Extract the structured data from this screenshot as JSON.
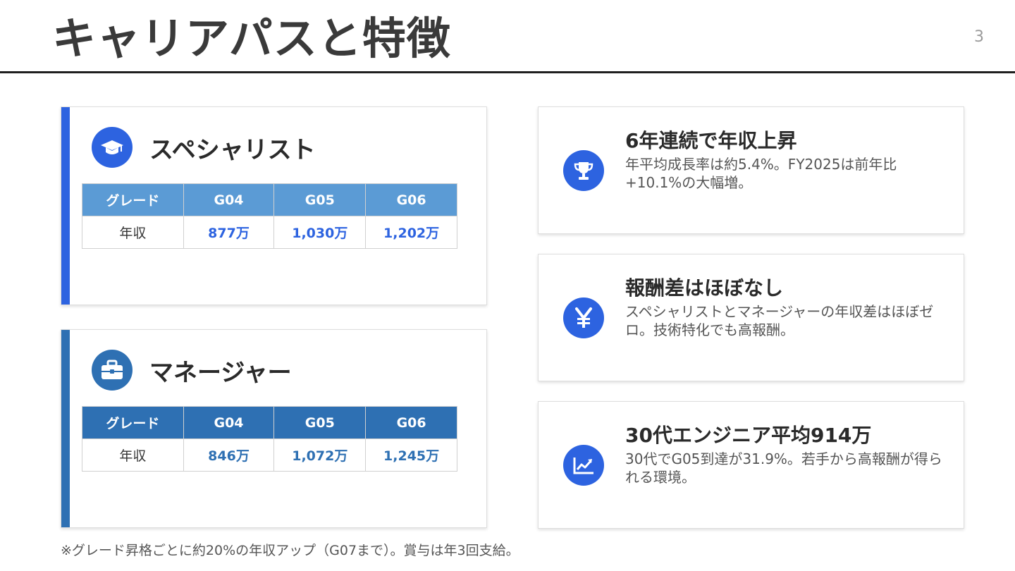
{
  "title": "キャリアパスと特徴",
  "page_number": "3",
  "specialist": {
    "icon": "graduation-cap-icon",
    "title": "スペシャリスト",
    "headers": [
      "グレード",
      "G04",
      "G05",
      "G06"
    ],
    "row_label": "年収",
    "values": [
      "877万",
      "1,030万",
      "1,202万"
    ]
  },
  "manager": {
    "icon": "briefcase-icon",
    "title": "マネージャー",
    "headers": [
      "グレード",
      "G04",
      "G05",
      "G06"
    ],
    "row_label": "年収",
    "values": [
      "846万",
      "1,072万",
      "1,245万"
    ]
  },
  "features": [
    {
      "icon": "trophy-icon",
      "title": "6年連続で年収上昇",
      "description": "年平均成長率は約5.4%。FY2025は前年比+10.1%の大幅増。"
    },
    {
      "icon": "yen-icon",
      "title": "報酬差はほぼなし",
      "description": "スペシャリストとマネージャーの年収差はほぼゼロ。技術特化でも高報酬。"
    },
    {
      "icon": "trend-chart-icon",
      "title": "30代エンジニア平均914万",
      "description": "30代でG05到達が31.9%。若手から高報酬が得られる環境。"
    }
  ],
  "footnote": "※グレード昇格ごとに約20%の年収アップ（G07まで）。賞与は年3回支給。",
  "colors": {
    "accent_blue": "#2d63e0",
    "manager_blue": "#2e70b3",
    "specialist_header": "#5b9bd5"
  }
}
